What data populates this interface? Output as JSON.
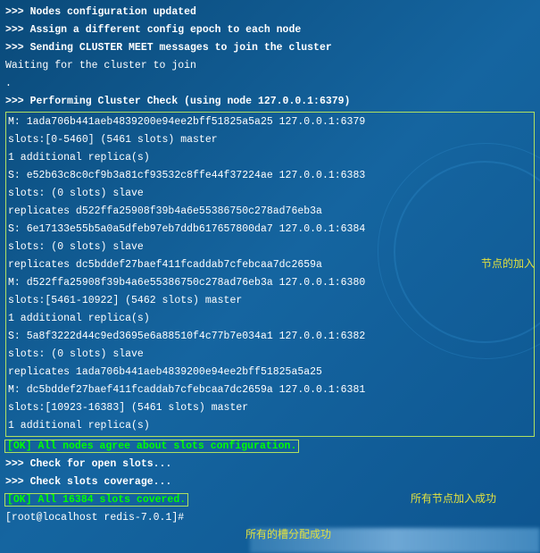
{
  "preamble": {
    "l1": ">>> Nodes configuration updated",
    "l2": ">>> Assign a different config epoch to each node",
    "l3": ">>> Sending CLUSTER MEET messages to join the cluster",
    "l4": "Waiting for the cluster to join",
    "l5_blank": ".",
    "l6": ">>> Performing Cluster Check (using node 127.0.0.1:6379)"
  },
  "nodes_block": {
    "m1_a": "M: 1ada706b441aeb4839200e94ee2bff51825a5a25 127.0.0.1:6379",
    "m1_b": "   slots:[0-5460] (5461 slots) master",
    "m1_c": "   1 additional replica(s)",
    "s1_a": "S: e52b63c8c0cf9b3a81cf93532c8ffe44f37224ae 127.0.0.1:6383",
    "s1_b": "   slots: (0 slots) slave",
    "s1_c": "   replicates d522ffa25908f39b4a6e55386750c278ad76eb3a",
    "s2_a": "S: 6e17133e55b5a0a5dfeb97eb7ddb617657800da7 127.0.0.1:6384",
    "s2_b": "   slots: (0 slots) slave",
    "s2_c": "   replicates dc5bddef27baef411fcaddab7cfebcaa7dc2659a",
    "m2_a": "M: d522ffa25908f39b4a6e55386750c278ad76eb3a 127.0.0.1:6380",
    "m2_b": "   slots:[5461-10922] (5462 slots) master",
    "m2_c": "   1 additional replica(s)",
    "s3_a": "S: 5a8f3222d44c9ed3695e6a88510f4c77b7e034a1 127.0.0.1:6382",
    "s3_b": "   slots: (0 slots) slave",
    "s3_c": "   replicates 1ada706b441aeb4839200e94ee2bff51825a5a25",
    "m3_a": "M: dc5bddef27baef411fcaddab7cfebcaa7dc2659a 127.0.0.1:6381",
    "m3_b": "   slots:[10923-16383] (5461 slots) master",
    "m3_c": "   1 additional replica(s)"
  },
  "post": {
    "ok1": "[OK] All nodes agree about slots configuration.",
    "check1": ">>> Check for open slots...",
    "check2": ">>> Check slots coverage...",
    "ok2": "[OK] All 16384 slots covered.",
    "prompt": "[root@localhost redis-7.0.1]#"
  },
  "annotations": {
    "a1": "节点的加入",
    "a2": "所有节点加入成功",
    "a3": "所有的槽分配成功"
  }
}
